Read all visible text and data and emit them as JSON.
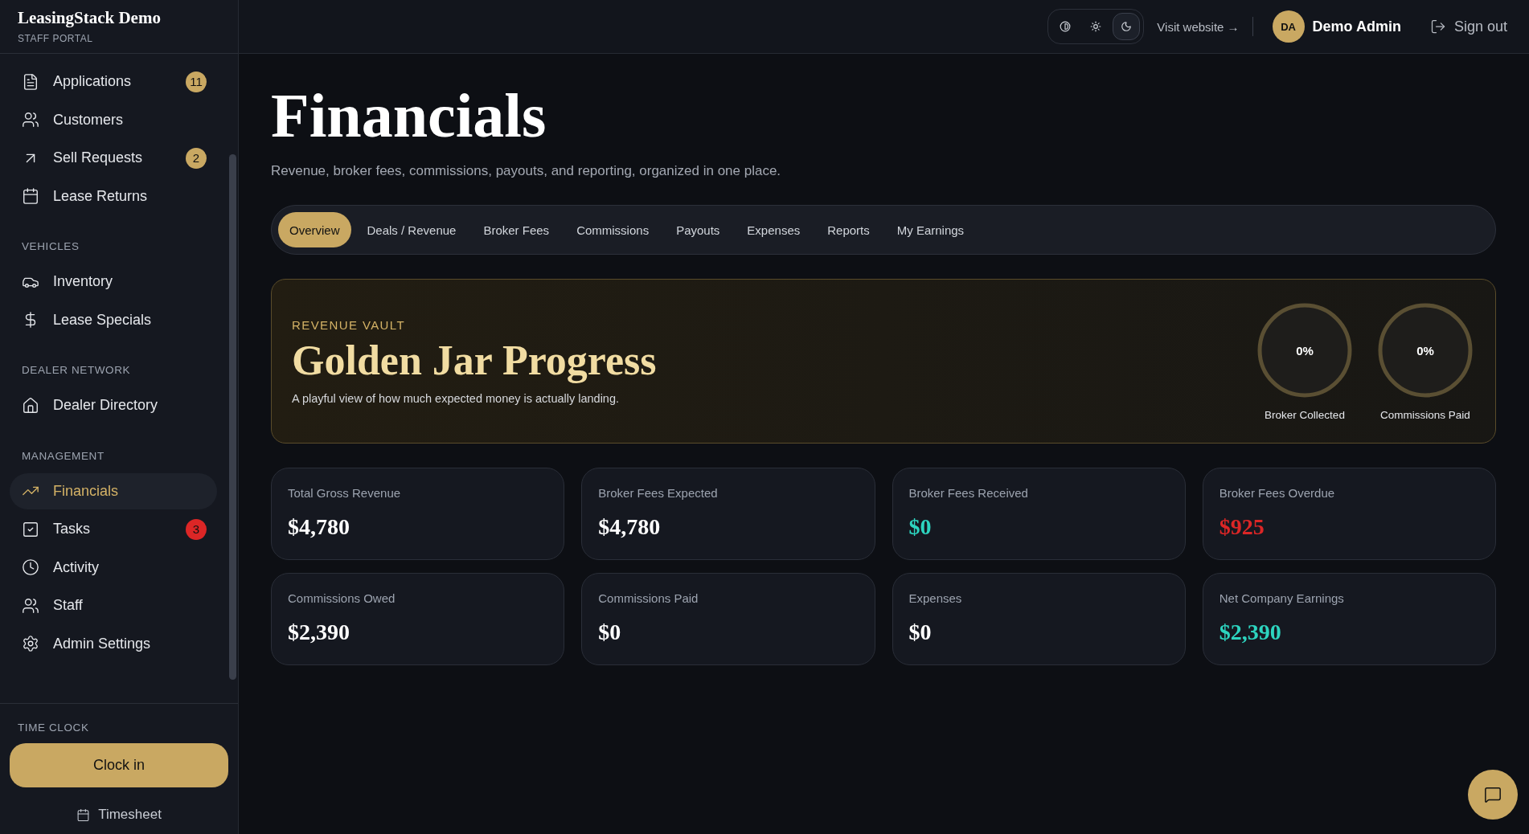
{
  "sidebar": {
    "brand": "LeasingStack Demo",
    "subtitle": "STAFF PORTAL",
    "sections": [
      {
        "items": [
          {
            "label": "Applications",
            "badge": "11",
            "color": "#c9a862",
            "selected": false
          },
          {
            "label": "Customers",
            "selected": false
          },
          {
            "label": "Sell Requests",
            "badge": "2",
            "color": "#c9a862",
            "selected": false
          },
          {
            "label": "Lease Returns",
            "selected": false
          }
        ]
      },
      {
        "title": "VEHICLES",
        "items": [
          {
            "label": "Inventory",
            "selected": false
          },
          {
            "label": "Lease Specials",
            "selected": false
          }
        ]
      },
      {
        "title": "DEALER NETWORK",
        "items": [
          {
            "label": "Dealer Directory",
            "selected": false
          }
        ]
      },
      {
        "title": "MANAGEMENT",
        "items": [
          {
            "label": "Financials",
            "selected": true
          },
          {
            "label": "Tasks",
            "badge": "3",
            "color": "#dc2626",
            "selected": false
          },
          {
            "label": "Activity",
            "selected": false
          },
          {
            "label": "Staff",
            "selected": false
          },
          {
            "label": "Admin Settings",
            "selected": false
          }
        ]
      }
    ],
    "time_clock": {
      "title": "TIME CLOCK",
      "button": "Clock in",
      "link": "Timesheet"
    }
  },
  "topbar": {
    "theme_options": [
      {
        "selected": false
      },
      {
        "selected": false
      },
      {
        "selected": true
      }
    ],
    "visit": "Visit website →",
    "user": {
      "initials": "DA",
      "name": "Demo Admin"
    },
    "sign_out": "Sign out"
  },
  "page": {
    "title": "Financials",
    "subtitle": "Revenue, broker fees, commissions, payouts, and reporting, organized in one place.",
    "tabs": [
      {
        "label": "Overview",
        "selected": true
      },
      {
        "label": "Deals / Revenue",
        "selected": false
      },
      {
        "label": "Broker Fees",
        "selected": false
      },
      {
        "label": "Commissions",
        "selected": false
      },
      {
        "label": "Payouts",
        "selected": false
      },
      {
        "label": "Expenses",
        "selected": false
      },
      {
        "label": "Reports",
        "selected": false
      },
      {
        "label": "My Earnings",
        "selected": false
      }
    ],
    "hero": {
      "eyebrow": "REVENUE VAULT",
      "title": "Golden Jar Progress",
      "text": "A playful view of how much expected money is actually landing.",
      "gauges": [
        {
          "value": "0%",
          "label": "Broker Collected",
          "level": 0
        },
        {
          "value": "0%",
          "label": "Commissions Paid",
          "level": 0
        }
      ]
    },
    "stats": [
      {
        "label": "Total Gross Revenue",
        "value": "$4,780",
        "color": "#ffffff"
      },
      {
        "label": "Broker Fees Expected",
        "value": "$4,780",
        "color": "#ffffff"
      },
      {
        "label": "Broker Fees Received",
        "value": "$0",
        "color": "#2dd4bf"
      },
      {
        "label": "Broker Fees Overdue",
        "value": "$925",
        "color": "#dc2626"
      },
      {
        "label": "Commissions Owed",
        "value": "$2,390",
        "color": "#ffffff"
      },
      {
        "label": "Commissions Paid",
        "value": "$0",
        "color": "#ffffff"
      },
      {
        "label": "Expenses",
        "value": "$0",
        "color": "#ffffff"
      },
      {
        "label": "Net Company Earnings",
        "value": "$2,390",
        "color": "#2dd4bf"
      }
    ]
  }
}
